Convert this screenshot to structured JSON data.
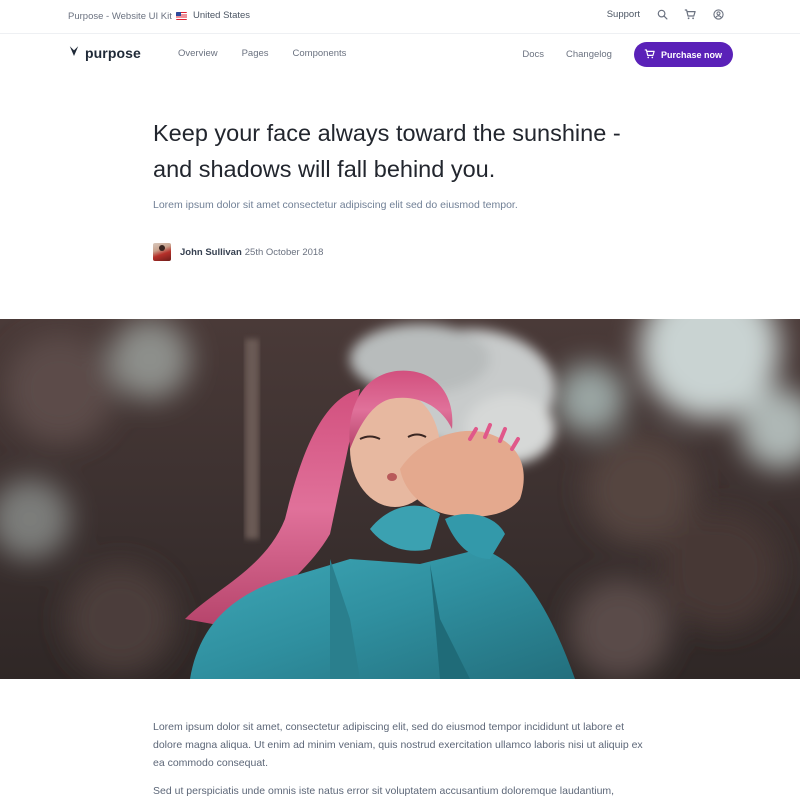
{
  "topbar": {
    "kit_label": "Purpose - Website UI Kit",
    "region_label": "United States",
    "support_label": "Support",
    "icons": [
      "search-icon",
      "cart-icon",
      "user-icon"
    ]
  },
  "nav": {
    "brand": "purpose",
    "links": [
      "Overview",
      "Pages",
      "Components"
    ],
    "right_links": [
      "Docs",
      "Changelog"
    ],
    "cta_label": "Purchase now",
    "accent_color": "#5a21b8"
  },
  "article": {
    "headline_line1": "Keep your face always toward the sunshine -",
    "headline_line2": "and shadows will fall behind you.",
    "lead": "Lorem ipsum dolor sit amet consectetur adipiscing elit sed do eiusmod tempor.",
    "author_name": "John Sullivan",
    "author_date": "25th October 2018",
    "paragraph1": "Lorem ipsum dolor sit amet, consectetur adipiscing elit, sed do eiusmod tempor incididunt ut labore et dolore magna aliqua. Ut enim ad minim veniam, quis nostrud exercitation ullamco laboris nisi ut aliquip ex ea commodo consequat.",
    "paragraph2": "Sed ut perspiciatis unde omnis iste natus error sit voluptatem accusantium doloremque laudantium,"
  }
}
